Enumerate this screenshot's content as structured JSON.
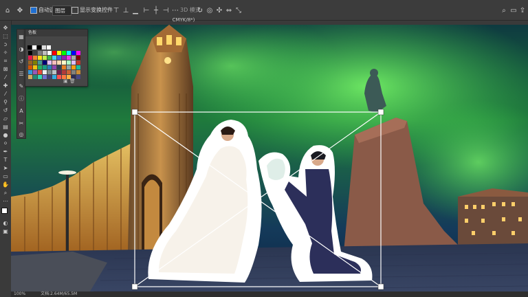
{
  "options_bar": {
    "auto_select_label": "自动选择:",
    "auto_select_value": "图层",
    "transform_controls_label": "显示变换控件",
    "mode_3d_label": "3D 模式:"
  },
  "document": {
    "tab_title": "CMYK/8*)"
  },
  "swatches_panel": {
    "title": "色板",
    "colors": [
      "#000000",
      "#404040",
      "#808080",
      "#bfbfbf",
      "#ffffff",
      "#ff0000",
      "#ffff00",
      "#00ff00",
      "#00ffff",
      "#0000ff",
      "#ff00ff",
      "#e6194b",
      "#f58231",
      "#ffe119",
      "#bfef45",
      "#3cb44b",
      "#42d4f4",
      "#4363d8",
      "#911eb4",
      "#f032e6",
      "#a9a9a9",
      "#800000",
      "#9a6324",
      "#808000",
      "#469990",
      "#000075",
      "#e6beff",
      "#fabebe",
      "#ffd8b1",
      "#fffac8",
      "#aaffc3",
      "#dcbeff",
      "#c0392b",
      "#d35400",
      "#f1c40f",
      "#27ae60",
      "#16a085",
      "#2980b9",
      "#8e44ad",
      "#2c3e50",
      "#e67e22",
      "#95a5a6",
      "#f39c12",
      "#1abc9c",
      "#3498db",
      "#9b59b6",
      "#e74c3c",
      "#ecf0f1",
      "#7f8c8d",
      "#bdc3c7",
      "#6d214f",
      "#b33939",
      "#cd6133",
      "#84817a",
      "#cc8e35",
      "#ccae62",
      "#218c74",
      "#33d9b2",
      "#706fd3",
      "#40407a",
      "#34ace0",
      "#ff5252",
      "#ff793f",
      "#ffb142",
      "#2c2c54",
      "#474787"
    ]
  },
  "status_bar": {
    "zoom": "100%",
    "doc_info": "文档:2.64M/65.5M"
  },
  "colors": {
    "app_bg": "#535353",
    "bar_bg": "#3c3c3c",
    "selection_stroke": "#ffffff"
  }
}
